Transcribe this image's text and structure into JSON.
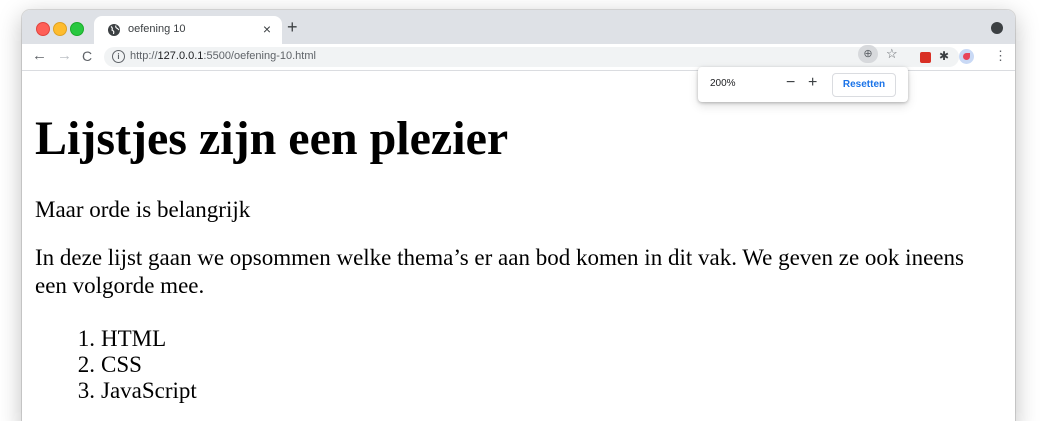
{
  "browser": {
    "tab_title": "oefening 10",
    "tab_close": "×",
    "new_tab": "+",
    "url_scheme": "http://",
    "url_host": "127.0.0.1",
    "url_rest": ":5500/oefening-10.html",
    "nav_back": "←",
    "nav_forward": "→",
    "nav_reload": "C",
    "info_glyph": "i",
    "star_glyph": "☆",
    "menu_glyph": "⋮",
    "puzzle_glyph": "✱",
    "zoom_glyph": "⊕"
  },
  "zoom_popup": {
    "level": "200%",
    "minus": "−",
    "plus": "+",
    "reset_label": "Resetten"
  },
  "page": {
    "heading": "Lijstjes zijn een plezier",
    "subtitle": "Maar orde is belangrijk",
    "intro": "In deze lijst gaan we opsommen welke thema’s er aan bod komen in dit vak. We geven ze ook ineens een volgorde mee.",
    "list": [
      {
        "num": "1.",
        "label": "HTML"
      },
      {
        "num": "2.",
        "label": "CSS"
      },
      {
        "num": "3.",
        "label": "JavaScript"
      }
    ]
  },
  "colors": {
    "tabstrip": "#dee1e6",
    "accent": "#1a73e8"
  }
}
